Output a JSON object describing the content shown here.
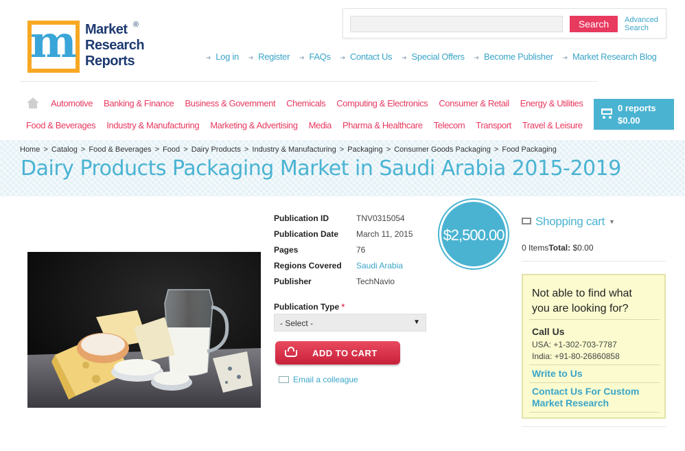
{
  "header": {
    "logo_lines": [
      "Market",
      "Research",
      "Reports"
    ],
    "logo_reg": "®",
    "search_placeholder": "",
    "search_button": "Search",
    "advanced_search_line1": "Advanced",
    "advanced_search_line2": "Search",
    "top_nav": [
      "Log in",
      "Register",
      "FAQs",
      "Contact Us",
      "Special Offers",
      "Become Publisher",
      "Market Research Blog"
    ]
  },
  "categories": {
    "row1": [
      "Automotive",
      "Banking & Finance",
      "Business & Government",
      "Chemicals",
      "Computing & Electronics",
      "Consumer & Retail",
      "Energy & Utilities"
    ],
    "row2": [
      "Food & Beverages",
      "Industry & Manufacturing",
      "Marketing & Advertising",
      "Media",
      "Pharma & Healthcare",
      "Telecom",
      "Transport",
      "Travel & Leisure"
    ]
  },
  "cart_widget": {
    "count": "0 reports",
    "total": "$0.00"
  },
  "breadcrumb": [
    "Home",
    "Catalog",
    "Food & Beverages",
    "Food",
    "Dairy Products",
    "Industry & Manufacturing",
    "Packaging",
    "Consumer Goods Packaging",
    "Food Packaging"
  ],
  "breadcrumb_sep": ">",
  "page_title": "Dairy Products Packaging Market in Saudi Arabia 2015-2019",
  "details": {
    "publication_id_label": "Publication ID",
    "publication_id": "TNV0315054",
    "publication_date_label": "Publication Date",
    "publication_date": "March 11, 2015",
    "pages_label": "Pages",
    "pages": "76",
    "regions_label": "Regions Covered",
    "regions": "Saudi Arabia",
    "publisher_label": "Publisher",
    "publisher": "TechNavio"
  },
  "publication_type": {
    "label": "Publication Type",
    "required_mark": "*",
    "selected": "- Select -",
    "caret": "▼"
  },
  "add_to_cart": "ADD TO CART",
  "email_colleague": "Email a colleague",
  "price": "$2,500.00",
  "shopping_cart": {
    "title": "Shopping cart",
    "items": "0 Items",
    "total_label": "Total:",
    "total": "$0.00"
  },
  "help_box": {
    "question_line1": "Not able to find what",
    "question_line2": "you are looking for?",
    "call_us": "Call Us",
    "usa_phone": "USA: +1-302-703-7787",
    "india_phone": "India: +91-80-26860858",
    "write_to_us": "Write to Us",
    "custom_line1": "Contact Us For Custom",
    "custom_line2": "Market Research"
  },
  "colors": {
    "accent_blue": "#4ab3d2",
    "accent_red": "#e8395f",
    "help_bg": "#fbfbcf"
  }
}
